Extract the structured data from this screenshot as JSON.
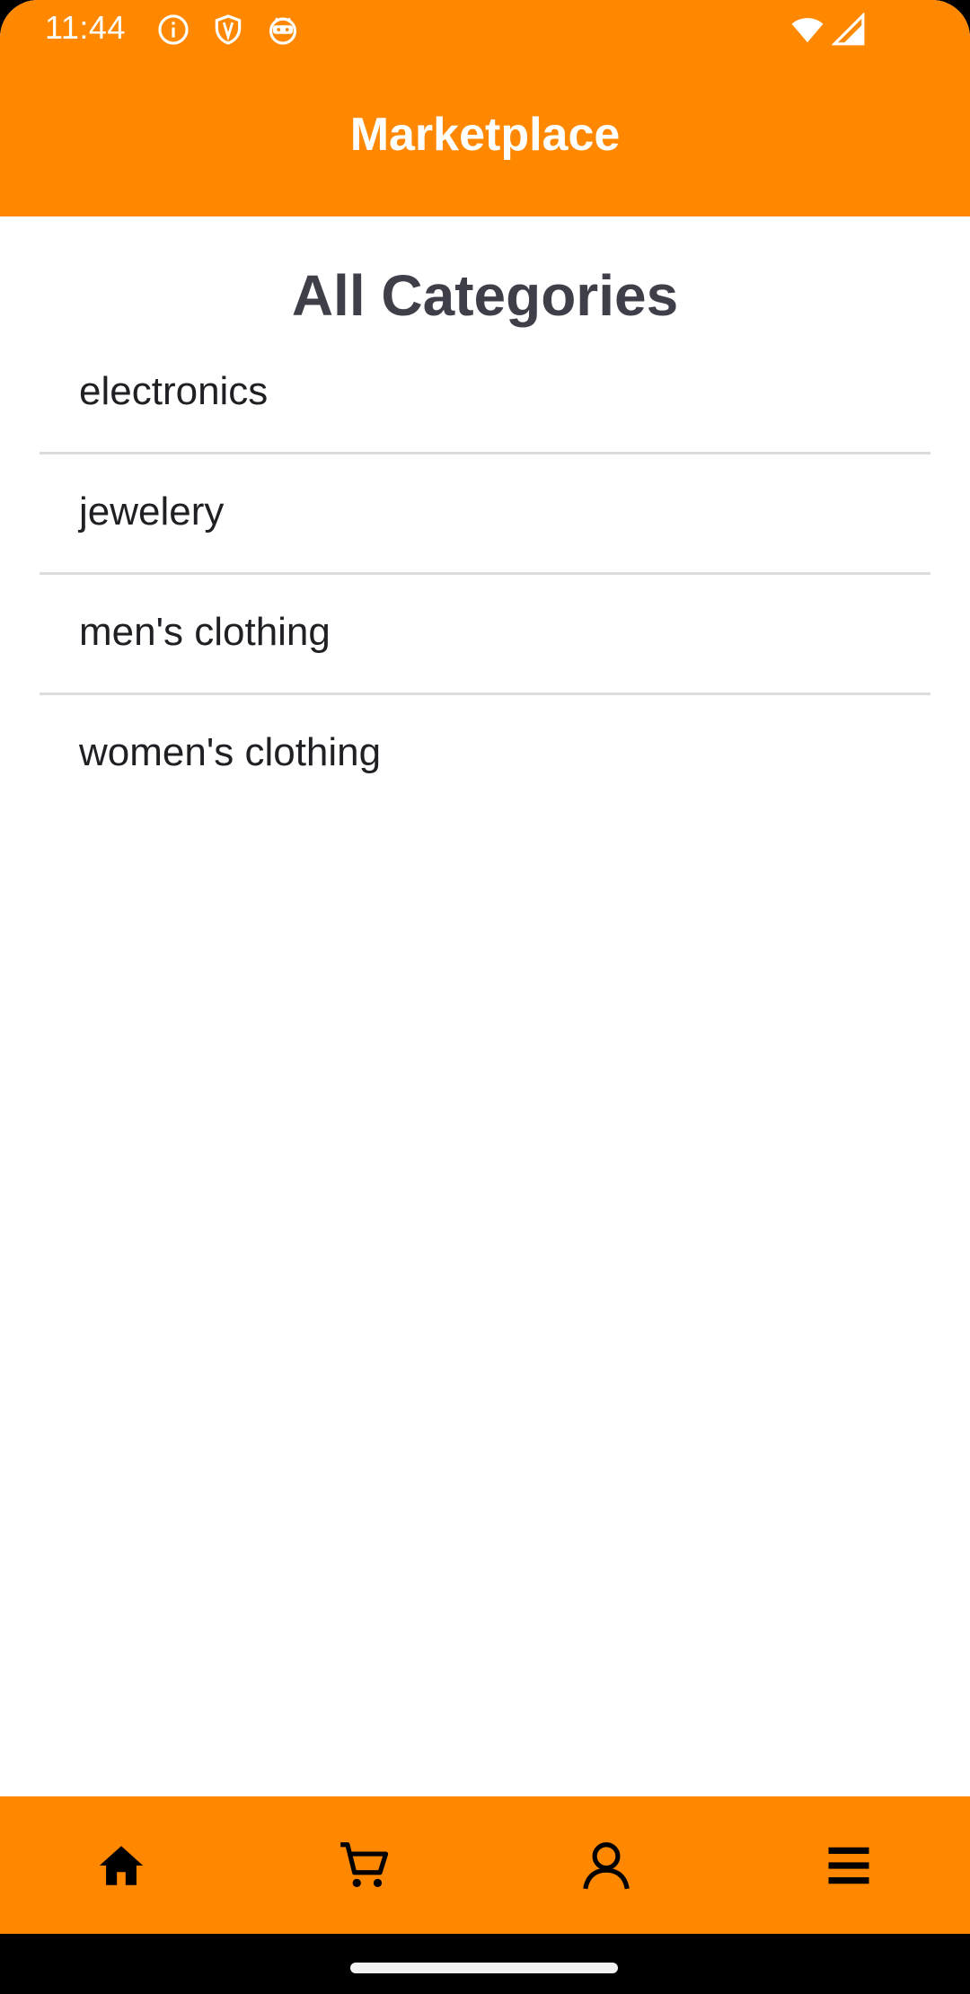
{
  "status_bar": {
    "time": "11:44",
    "icons": [
      "info-icon",
      "shield-icon",
      "android-face-icon",
      "wifi-icon",
      "signal-icon"
    ]
  },
  "app_bar": {
    "title": "Marketplace"
  },
  "main": {
    "heading": "All Categories",
    "categories": [
      {
        "label": "electronics"
      },
      {
        "label": "jewelery"
      },
      {
        "label": "men's clothing"
      },
      {
        "label": "women's clothing"
      }
    ]
  },
  "bottom_nav": {
    "items": [
      {
        "icon": "home-icon"
      },
      {
        "icon": "cart-icon"
      },
      {
        "icon": "profile-icon"
      },
      {
        "icon": "menu-icon"
      }
    ]
  },
  "colors": {
    "accent": "#FF8800",
    "heading": "#3f3f4a",
    "text": "#1f1f24",
    "divider": "#dcdcdc"
  }
}
